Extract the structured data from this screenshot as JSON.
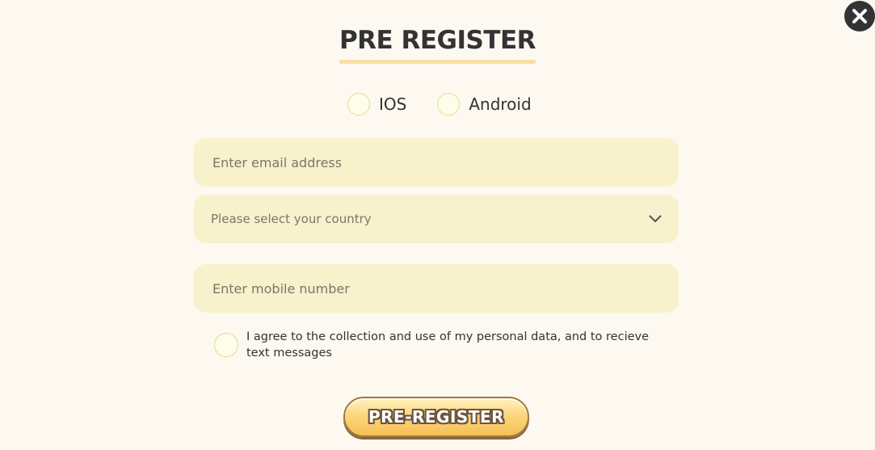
{
  "title": "PRE REGISTER",
  "close_icon": "close-icon",
  "platforms": [
    {
      "label": "IOS",
      "selected": false
    },
    {
      "label": "Android",
      "selected": false
    }
  ],
  "form": {
    "email_placeholder": "Enter email address",
    "country_placeholder": "Please select your country",
    "mobile_placeholder": "Enter mobile number"
  },
  "agreement": {
    "text": "I agree to the collection and use of my personal data, and to recieve text messages",
    "checked": false
  },
  "submit_label": "PRE-REGISTER",
  "colors": {
    "background": "#fdf8f0",
    "field": "#f7f1cc",
    "radio_border": "#e2dc93",
    "title_underline": "#fadfa3",
    "button": "#fcd77e",
    "button_outline": "#6e553b"
  }
}
